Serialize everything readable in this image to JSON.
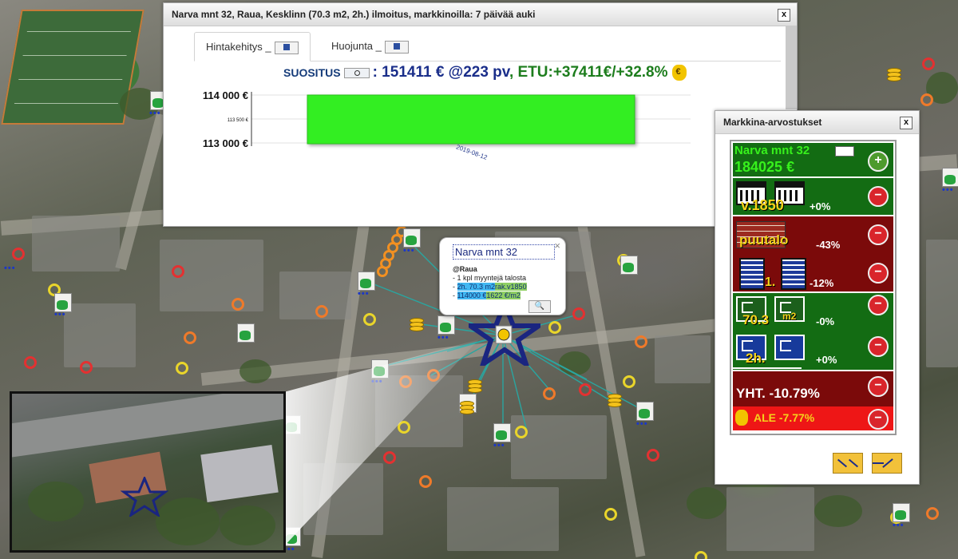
{
  "main_dialog": {
    "title": "Narva mnt 32, Raua, Kesklinn (70.3 m2, 2h.) ilmoitus, markkinoilla: 7 päivää auki",
    "close_label": "x",
    "tabs": [
      {
        "label": "Hintakehitys _"
      },
      {
        "label": "Huojunta _"
      }
    ],
    "recommendation": {
      "label": "SUOSITUS",
      "value": ": 151411 € @223 pv",
      "gain": ", ETU:+37411€/+32.8%"
    }
  },
  "chart_data": {
    "type": "bar",
    "categories": [
      "2019-08-12"
    ],
    "values": [
      114000
    ],
    "ylim": [
      113000,
      114000
    ],
    "y_ticks": [
      {
        "value": 114000,
        "label": "114 000 €"
      },
      {
        "value": 113500,
        "label": "113 500 €"
      },
      {
        "value": 113000,
        "label": "113 000 €"
      }
    ],
    "bar_color": "#33ee22",
    "grid": true
  },
  "popup": {
    "title": "Narva mnt 32",
    "close_label": "×",
    "district": "@Raua",
    "line1": "- 1 kpl myyntejä talosta",
    "line2_prefix": "-",
    "line2_area": "2h. 70.3 m2",
    "line2_year": "rak.v1850",
    "line3_prefix": "-",
    "line3_price": "114000 €",
    "line3_sqm": "1622 €/m2"
  },
  "market_panel": {
    "title": "Markkina-arvostukset",
    "close_label": "x",
    "address": "Narva mnt 32",
    "price": "184025 €",
    "rows": [
      {
        "label": "v.1850",
        "pct": "+0%"
      },
      {
        "label": "puutalo",
        "pct": "-43%"
      },
      {
        "label": "1.",
        "pct": "-12%"
      },
      {
        "label": "70.3",
        "unit": "m2",
        "pct": "-0%"
      },
      {
        "label": "2h.",
        "pct": "+0%"
      }
    ],
    "total": "YHT. -10.79%",
    "discount": "ALE -7.77%",
    "plus_label": "+",
    "minus_label": "−"
  },
  "colors": {
    "green_row": "#136c13",
    "red_row": "#7b0a0a",
    "bright_red": "#ee1616",
    "star": "#1a2580",
    "ray": "#2aa5a0"
  }
}
